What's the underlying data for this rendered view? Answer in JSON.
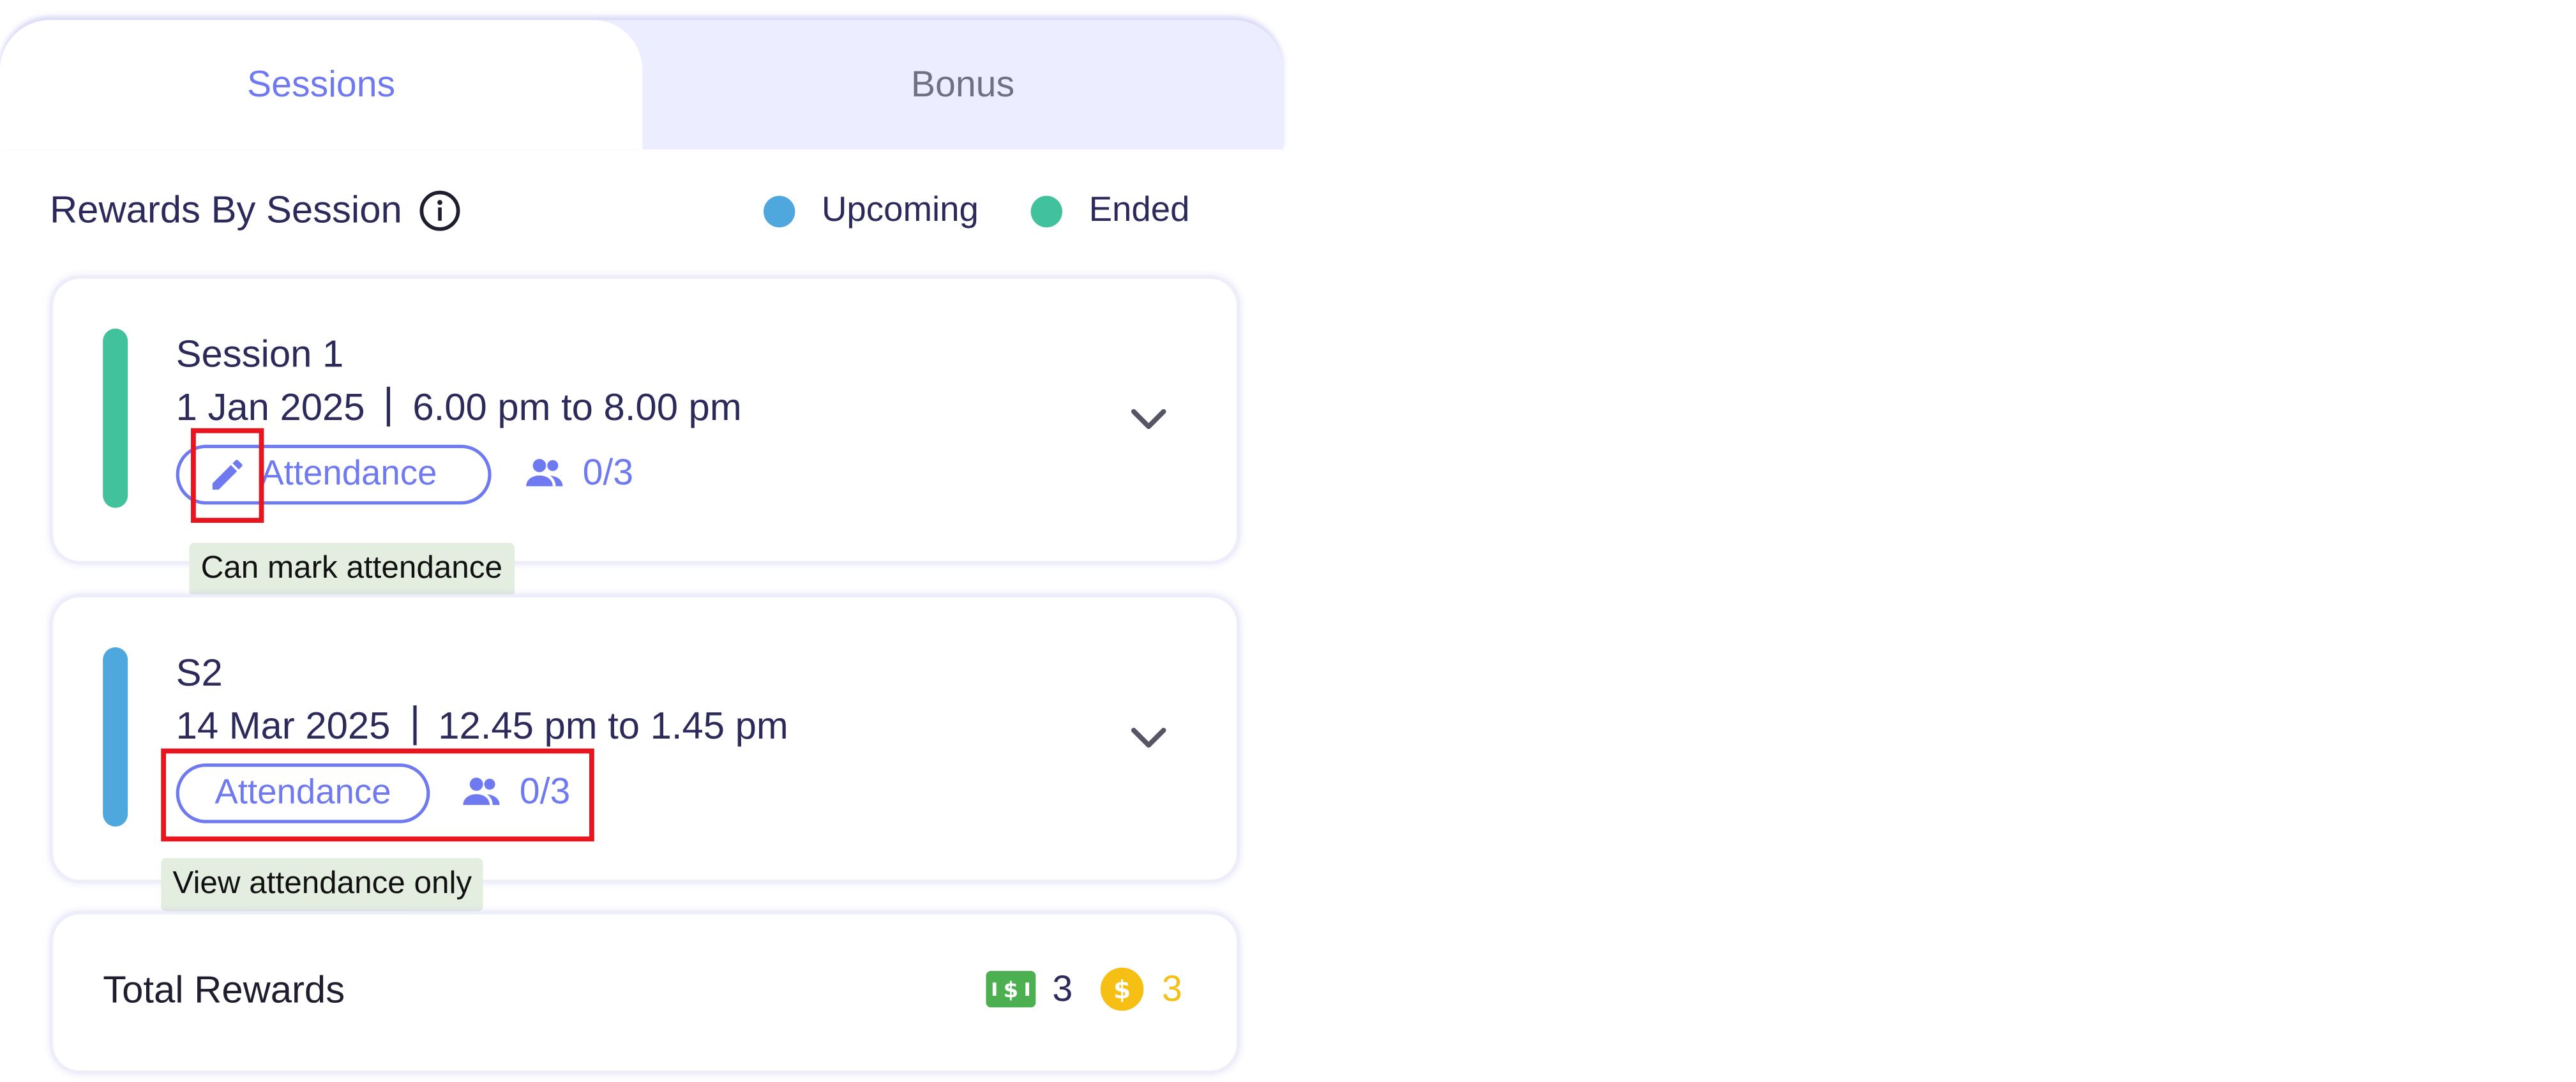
{
  "tabs": {
    "sessions": "Sessions",
    "bonus": "Bonus"
  },
  "heading": {
    "title": "Rewards By Session"
  },
  "legend": {
    "upcoming": "Upcoming",
    "ended": "Ended",
    "upcoming_color": "#4ea7dd",
    "ended_color": "#41c19c"
  },
  "sessions": [
    {
      "title": "Session 1",
      "date": "1 Jan 2025",
      "time": "6.00 pm to 8.00 pm",
      "attendance_label": "Attendance",
      "count": "0/3",
      "status": "ended",
      "tooltip": "Can mark attendance"
    },
    {
      "title": "S2",
      "date": "14 Mar 2025",
      "time": "12.45 pm to 1.45 pm",
      "attendance_label": "Attendance",
      "count": "0/3",
      "status": "upcoming",
      "tooltip": "View attendance only"
    }
  ],
  "total": {
    "label": "Total Rewards",
    "cash_value": "3",
    "coin_value": "3",
    "cash_icon": "cash-icon",
    "coin_icon": "coin-icon"
  },
  "colors": {
    "accent": "#6f7af0",
    "highlight": "#e8141e",
    "tooltip_bg": "#e4eee0",
    "coin": "#f5c013",
    "cash": "#4cb050"
  }
}
